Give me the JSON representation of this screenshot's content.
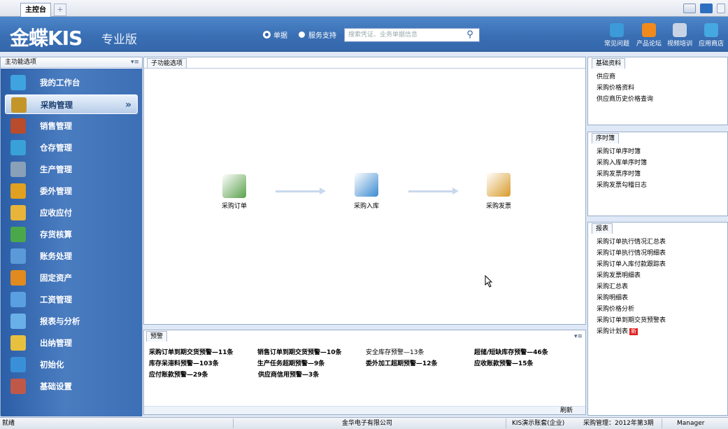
{
  "tabbar": {
    "main_tab": "主控台",
    "add_tab": "+"
  },
  "header": {
    "logo": "金蝶KIS",
    "logo_sub": "专业版",
    "radio_bill": "单据",
    "radio_support": "服务支持",
    "search_placeholder": "搜索凭证、业务单据信息",
    "buttons": [
      "常见问题",
      "产品论坛",
      "视频培训",
      "应用商店"
    ]
  },
  "sidebar": {
    "title": "主功能选项",
    "items": [
      {
        "label": "我的工作台",
        "color": "#3fa3e0"
      },
      {
        "label": "采购管理",
        "color": "#c4962a"
      },
      {
        "label": "销售管理",
        "color": "#b84c2c"
      },
      {
        "label": "仓存管理",
        "color": "#3aa0d8"
      },
      {
        "label": "生产管理",
        "color": "#8aa0b8"
      },
      {
        "label": "委外管理",
        "color": "#e0a020"
      },
      {
        "label": "应收应付",
        "color": "#e8b43a"
      },
      {
        "label": "存货核算",
        "color": "#4aa84a"
      },
      {
        "label": "账务处理",
        "color": "#5a9ad8"
      },
      {
        "label": "固定资产",
        "color": "#e08a20"
      },
      {
        "label": "工资管理",
        "color": "#5aa0e0"
      },
      {
        "label": "报表与分析",
        "color": "#6ab0e8"
      },
      {
        "label": "出纳管理",
        "color": "#e8c040"
      },
      {
        "label": "初始化",
        "color": "#3a90d8"
      },
      {
        "label": "基础设置",
        "color": "#c05848"
      }
    ]
  },
  "main": {
    "title": "子功能选项",
    "flow": [
      {
        "label": "采购订单",
        "color": "#5aa04a"
      },
      {
        "label": "采购入库",
        "color": "#3a8ad0"
      },
      {
        "label": "采购发票",
        "color": "#d89a28"
      }
    ]
  },
  "warn": {
    "title": "预警",
    "rows": [
      [
        "采购订单到期交货预警—11条",
        "销售订单到期交货预警—10条",
        "安全库存预警—13条",
        "超储/短缺库存预警—46条"
      ],
      [
        "库存呆滞料预警—103条",
        "生产任务超期预警—9条",
        "委外加工超期预警—12条",
        "应收账款预警—15条"
      ],
      [
        "应付账款预警—29条",
        "供应商信用预警—3条",
        "",
        ""
      ]
    ],
    "refresh": "刷新"
  },
  "right": {
    "basic": {
      "title": "基础资料",
      "items": [
        "供应商",
        "采购价格资料",
        "供应商历史价格查询"
      ]
    },
    "seq": {
      "title": "序时簿",
      "items": [
        "采购订单序时簿",
        "采购入库单序时簿",
        "采购发票序时簿",
        "采购发票勾稽日志"
      ]
    },
    "report": {
      "title": "报表",
      "items": [
        "采购订单执行情况汇总表",
        "采购订单执行情况明细表",
        "采购订单入库付款跟踪表",
        "采购发票明细表",
        "采购汇总表",
        "采购明细表",
        "采购价格分析",
        "采购订单到期交货预警表",
        "采购计划表"
      ],
      "new_badge": "新"
    }
  },
  "status": {
    "left": "就绪",
    "company": "金华电子有限公司",
    "account": "KIS演示账套(企业)",
    "period": "采购管理：2012年第3期",
    "user": "Manager"
  }
}
